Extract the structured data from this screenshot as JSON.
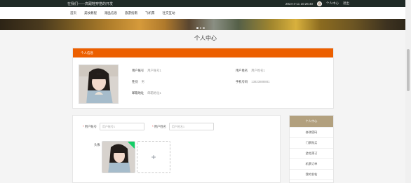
{
  "topbar": {
    "system_name": "在我们——高跟鞋穿搭的开发",
    "datetime": "2024-4-11 10:26:40",
    "user_link": "个人中心",
    "logout": "退出"
  },
  "nav": {
    "items": [
      "首页",
      "美妆教程",
      "潮品信息",
      "旅游指南",
      "飞机票",
      "社交互动"
    ]
  },
  "page_title": "个人中心",
  "info_card": {
    "header": "个人信息",
    "account_label": "用户账号",
    "account_value": "用户账号1",
    "gender_label": "性别",
    "gender_value": "男",
    "email_label": "邮箱地址",
    "email_value": "邮箱地址1",
    "name_label": "用户姓名",
    "name_value": "用户姓名1",
    "phone_label": "手机号码",
    "phone_value": "13823888881"
  },
  "form": {
    "account_label": "用户账号",
    "account_value": "用户账号1",
    "name_label": "用户姓名",
    "name_value": "用户姓名1",
    "avatar_label": "头像",
    "add_symbol": "+"
  },
  "side_menu": {
    "items": [
      "个人中心",
      "修改密码",
      "门票购买",
      "游览预订",
      "机票订单",
      "我的发帖"
    ]
  },
  "colors": {
    "accent": "#ec5f00",
    "side_active": "#b2a07e",
    "topbar": "#1f2a26"
  }
}
